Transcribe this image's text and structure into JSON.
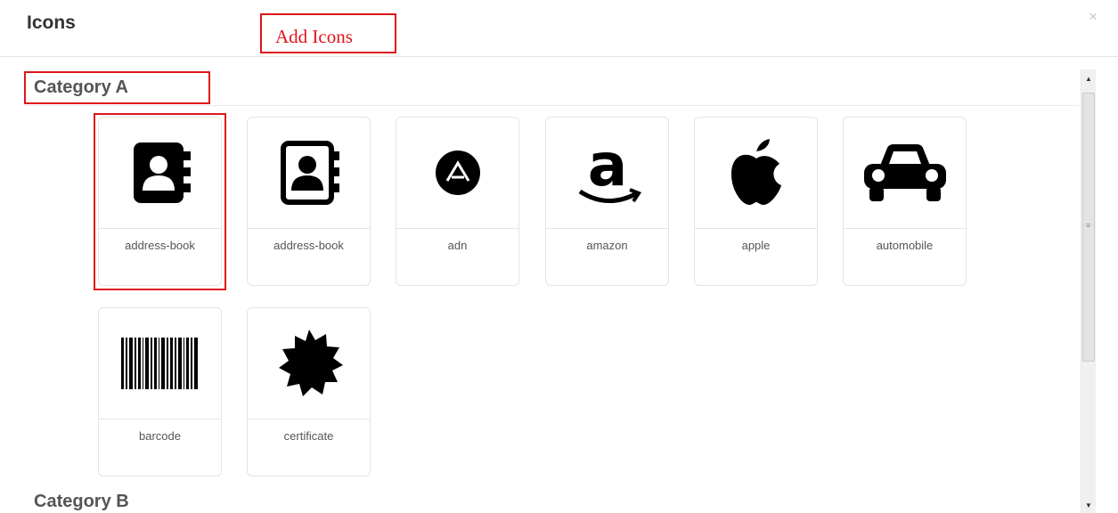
{
  "header": {
    "title": "Icons",
    "close_label": "×",
    "annotation": "Add Icons"
  },
  "categories": [
    {
      "name": "Category A",
      "icons": [
        {
          "label": "address-book",
          "icon": "address-book-icon"
        },
        {
          "label": "address-book",
          "icon": "address-book-outline-icon"
        },
        {
          "label": "adn",
          "icon": "adn-icon"
        },
        {
          "label": "amazon",
          "icon": "amazon-icon"
        },
        {
          "label": "apple",
          "icon": "apple-icon"
        },
        {
          "label": "automobile",
          "icon": "automobile-icon"
        },
        {
          "label": "barcode",
          "icon": "barcode-icon"
        },
        {
          "label": "certificate",
          "icon": "certificate-icon"
        }
      ]
    },
    {
      "name": "Category B",
      "icons": []
    }
  ],
  "selected_icon_index": 0,
  "scrollbar": {
    "up_arrow": "▲",
    "down_arrow": "▼",
    "grip": "≡"
  },
  "colors": {
    "annotation_red": "#e0141b",
    "icon_black": "#000000",
    "card_border": "#e4e4e4"
  }
}
